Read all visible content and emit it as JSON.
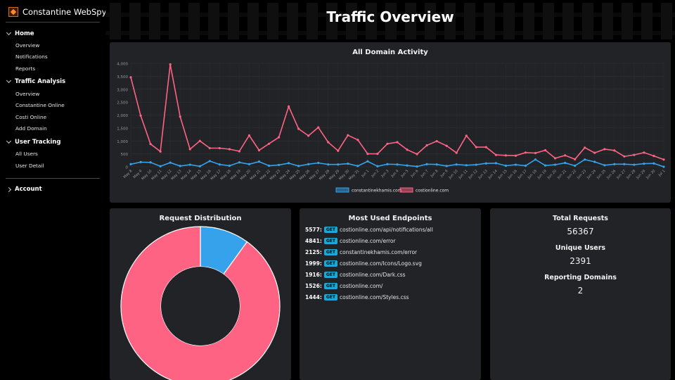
{
  "app": {
    "name": "Constantine WebSpy"
  },
  "sidebar": {
    "sections": [
      {
        "label": "Home",
        "items": [
          "Overview",
          "Notifications",
          "Reports"
        ]
      },
      {
        "label": "Traffic Analysis",
        "items": [
          "Overview",
          "Constantine Online",
          "Costi Online",
          "Add Domain"
        ]
      },
      {
        "label": "User Tracking",
        "items": [
          "All Users",
          "User Detail"
        ]
      }
    ],
    "account": "Account"
  },
  "page": {
    "title": "Traffic Overview"
  },
  "line_chart": {
    "title": "All Domain Activity",
    "legend": [
      "constantinekhamis.com",
      "costionline.com"
    ]
  },
  "distribution": {
    "title": "Request Distribution"
  },
  "endpoints": {
    "title": "Most Used Endpoints",
    "rows": [
      {
        "count": "5577:",
        "method": "GET",
        "path": "costionline.com/api/notifications/all"
      },
      {
        "count": "4841:",
        "method": "GET",
        "path": "costionline.com/error"
      },
      {
        "count": "2125:",
        "method": "GET",
        "path": "constantinekhamis.com/error"
      },
      {
        "count": "1999:",
        "method": "GET",
        "path": "costionline.com/Icons/Logo.svg"
      },
      {
        "count": "1916:",
        "method": "GET",
        "path": "costionline.com/Dark.css"
      },
      {
        "count": "1526:",
        "method": "GET",
        "path": "costionline.com/"
      },
      {
        "count": "1444:",
        "method": "GET",
        "path": "costionline.com/Styles.css"
      }
    ]
  },
  "stats": {
    "total_requests_label": "Total Requests",
    "total_requests": "56367",
    "unique_users_label": "Unique Users",
    "unique_users": "2391",
    "reporting_domains_label": "Reporting Domains",
    "reporting_domains": "2"
  },
  "colors": {
    "series_a": "#36a2eb",
    "series_b": "#ff6384",
    "panel": "#212326"
  },
  "chart_data": [
    {
      "type": "line",
      "title": "All Domain Activity",
      "ylim": [
        0,
        4000
      ],
      "yticks": [
        "0",
        "500",
        "1,000",
        "1,500",
        "2,000",
        "2,500",
        "3,000",
        "3,500",
        "4,000"
      ],
      "grid": true,
      "legend_position": "bottom",
      "x": [
        "May 8",
        "May 9",
        "May 10",
        "May 11",
        "May 12",
        "May 13",
        "May 14",
        "May 15",
        "May 16",
        "May 17",
        "May 18",
        "May 19",
        "May 20",
        "May 21",
        "May 22",
        "May 23",
        "May 24",
        "May 25",
        "May 26",
        "May 27",
        "May 28",
        "May 29",
        "May 30",
        "May 31",
        "Jun 1",
        "Jun 2",
        "Jun 3",
        "Jun 4",
        "Jun 5",
        "Jun 6",
        "Jun 7",
        "Jun 8",
        "Jun 9",
        "Jun 10",
        "Jun 11",
        "Jun 12",
        "Jun 13",
        "Jun 14",
        "Jun 15",
        "Jun 16",
        "Jun 17",
        "Jun 18",
        "Jun 19",
        "Jun 20",
        "Jun 21",
        "Jun 22",
        "Jun 23",
        "Jun 24",
        "Jun 25",
        "Jun 26",
        "Jun 27",
        "Jun 28",
        "Jun 29",
        "Jun 30",
        "Jul 1"
      ],
      "series": [
        {
          "name": "constantinekhamis.com",
          "values": [
            100,
            180,
            170,
            20,
            160,
            30,
            80,
            20,
            220,
            90,
            40,
            170,
            100,
            200,
            40,
            70,
            140,
            30,
            100,
            150,
            90,
            90,
            120,
            30,
            210,
            20,
            100,
            90,
            50,
            10,
            100,
            90,
            30,
            90,
            60,
            80,
            130,
            140,
            40,
            80,
            40,
            280,
            50,
            80,
            150,
            40,
            280,
            190,
            60,
            100,
            100,
            80,
            120,
            130,
            0
          ]
        },
        {
          "name": "costionline.com",
          "values": [
            3460,
            1980,
            880,
            590,
            3960,
            1940,
            680,
            1000,
            720,
            720,
            680,
            600,
            1210,
            640,
            890,
            1140,
            2330,
            1470,
            1200,
            1520,
            950,
            620,
            1220,
            1040,
            500,
            500,
            890,
            950,
            660,
            490,
            830,
            990,
            810,
            540,
            1200,
            760,
            760,
            460,
            440,
            430,
            550,
            530,
            640,
            330,
            440,
            290,
            740,
            540,
            680,
            630,
            400,
            460,
            550,
            420,
            280
          ]
        }
      ]
    },
    {
      "type": "pie",
      "title": "Request Distribution",
      "labels": [
        "constantinekhamis.com",
        "costionline.com"
      ],
      "values": [
        5,
        45
      ]
    }
  ]
}
